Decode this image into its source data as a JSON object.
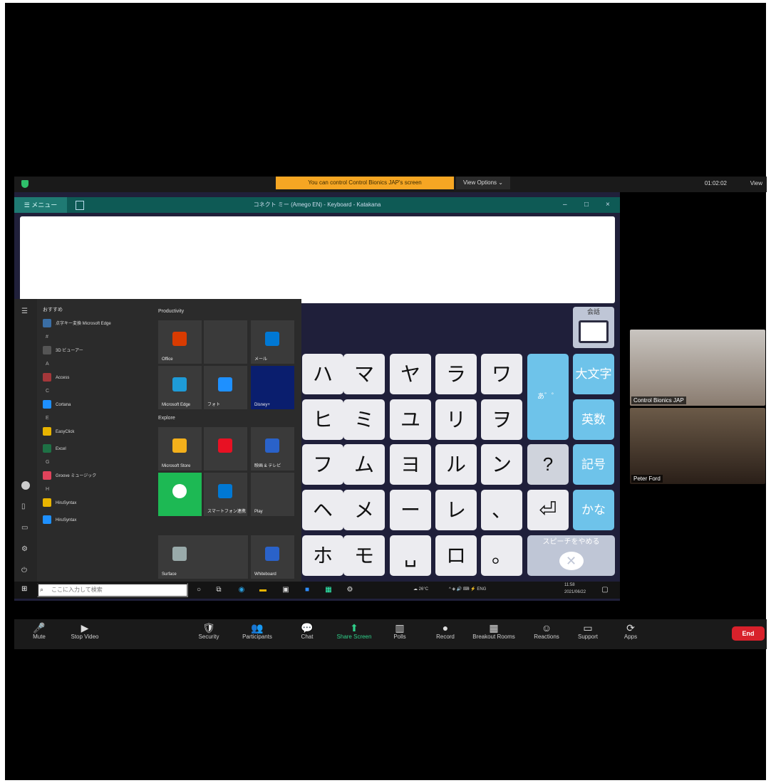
{
  "zoom": {
    "banner": "You can control Control Bionics JAP's screen",
    "view_options": "View Options ⌄",
    "timer": "01:02:02",
    "view_label": "View"
  },
  "app": {
    "menu_label": "☰ メニュー",
    "title": "コネクト ミー (Amego EN) - Keyboard - Katakana",
    "minimize": "–",
    "maximize": "□",
    "close": "×"
  },
  "keyboard": {
    "kaiwa_label": "会話",
    "rows": [
      [
        "ハ",
        "マ",
        "ヤ",
        "ラ",
        "ワ"
      ],
      [
        "ヒ",
        "ミ",
        "ユ",
        "リ",
        "ヲ"
      ],
      [
        "フ",
        "ム",
        "ヨ",
        "ル",
        "ン"
      ],
      [
        "ヘ",
        "メ",
        "ー",
        "レ",
        "、"
      ],
      [
        "ホ",
        "モ",
        "␣",
        "ロ",
        "。"
      ]
    ],
    "small_kana": "あ゛゜",
    "question": "?",
    "enter": "⏎",
    "side": [
      "大文字",
      "英数",
      "記号",
      "かな"
    ],
    "stop_speech": "スピーチをやめる",
    "stop_x": "✕"
  },
  "start_menu": {
    "list_title": "おすすめ",
    "apps": [
      {
        "letter": "",
        "name": "点字キー変換 Microsoft Edge",
        "color": "#3a6ea5"
      },
      {
        "letter": "#",
        "name": "3D ビューアー",
        "color": "#555"
      },
      {
        "letter": "A",
        "name": "Access",
        "color": "#a4373a"
      },
      {
        "letter": "C",
        "name": "Cortana",
        "color": "#1e90ff"
      },
      {
        "letter": "E",
        "name": "EasyClick",
        "color": "#e8b400"
      },
      {
        "letter": "",
        "name": "Excel",
        "color": "#1e7145"
      },
      {
        "letter": "G",
        "name": "Groove ミュージック",
        "color": "#e0435b"
      },
      {
        "letter": "H",
        "name": "HiruSyntax",
        "color": "#e8b400"
      },
      {
        "letter": "",
        "name": "HiruSyntax",
        "color": "#1e90ff"
      }
    ],
    "productivity": "Productivity",
    "explore": "Explore",
    "tiles": [
      {
        "label": "Office",
        "color": "#d83b01"
      },
      {
        "label": "",
        "color": "#3a3a3a"
      },
      {
        "label": "メール",
        "color": "#0078d4"
      },
      {
        "label": "Microsoft Edge",
        "color": "#1e9bd7"
      },
      {
        "label": "フォト",
        "color": "#1e90ff"
      },
      {
        "label": "Disney+",
        "color": "#0a1e6e"
      },
      {
        "label": "Microsoft Store",
        "color": "#f3b01b"
      },
      {
        "label": "",
        "color": "#e81123"
      },
      {
        "label": "映画 & テレビ",
        "color": "#2a62c9"
      },
      {
        "label": "",
        "color": "#1db954"
      },
      {
        "label": "スマートフォン連携",
        "color": "#0078d4"
      },
      {
        "label": "Play",
        "color": "#3a3a3a"
      },
      {
        "label": "Surface",
        "color": "#9aa"
      },
      {
        "label": "Whiteboard",
        "color": "#2a62c9"
      }
    ]
  },
  "taskbar": {
    "start": "⊞",
    "search_placeholder": "ここに入力して検索",
    "weather": "☁ 26°C",
    "tray_icons": "^ ◈ 🔊 ⌨ ⚡ ENG",
    "clock_time": "11:58",
    "clock_date": "2021/06/22"
  },
  "participants": [
    {
      "name": "Control Bionics JAP",
      "bg": "#c9c5c0"
    },
    {
      "name": "Peter Ford",
      "bg": "#6b5a48"
    }
  ],
  "toolbar": [
    {
      "name": "mute",
      "glyph": "🎤",
      "label": "Mute"
    },
    {
      "name": "stop-video",
      "glyph": "▶",
      "label": "Stop Video"
    },
    {
      "name": "security",
      "glyph": "🛡",
      "label": "Security"
    },
    {
      "name": "participants",
      "glyph": "👥",
      "label": "Participants"
    },
    {
      "name": "chat",
      "glyph": "💬",
      "label": "Chat"
    },
    {
      "name": "share-screen",
      "glyph": "⬆",
      "label": "Share Screen"
    },
    {
      "name": "polls",
      "glyph": "▥",
      "label": "Polls"
    },
    {
      "name": "record",
      "glyph": "●",
      "label": "Record"
    },
    {
      "name": "breakout-rooms",
      "glyph": "▦",
      "label": "Breakout Rooms"
    },
    {
      "name": "reactions",
      "glyph": "☺",
      "label": "Reactions"
    },
    {
      "name": "support",
      "glyph": "▭",
      "label": "Support"
    },
    {
      "name": "apps",
      "glyph": "⟳",
      "label": "Apps"
    }
  ],
  "end_label": "End"
}
